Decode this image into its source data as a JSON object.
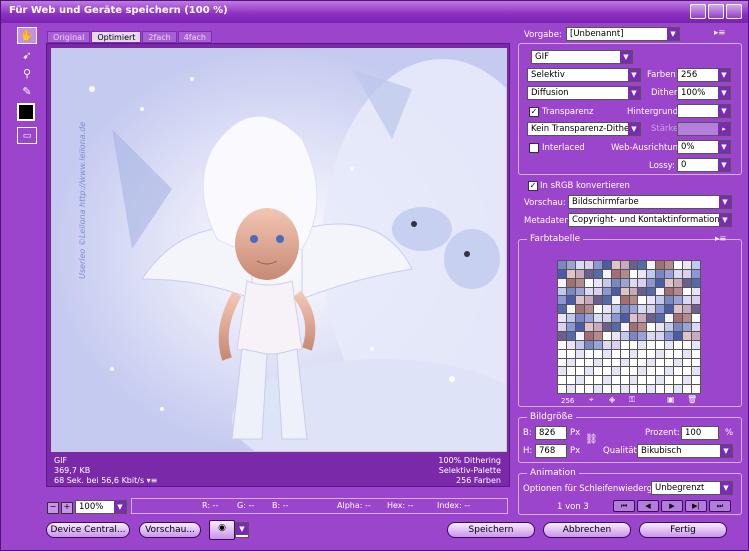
{
  "window": {
    "title": "Für Web und Geräte speichern (100 %)"
  },
  "tabs": [
    "Original",
    "Optimiert",
    "2fach",
    "4fach"
  ],
  "preview": {
    "info_left": [
      "GIF",
      "369,7 KB",
      "68 Sek. bei 56,6 Kbit/s"
    ],
    "info_right": [
      "100% Dithering",
      "Selektiv-Palette",
      "256 Farben"
    ],
    "watermark": "Userleo ©Leilona http://www.leilona.de"
  },
  "settings": {
    "preset_label": "Vorgabe:",
    "preset_value": "[Unbenannt]",
    "format": "GIF",
    "reduction": "Selektiv",
    "colors_label": "Farben:",
    "colors_value": "256",
    "dither_method": "Diffusion",
    "dither_label": "Dither:",
    "dither_value": "100%",
    "transparency_label": "Transparenz",
    "matte_label": "Hintergrund:",
    "transparency_dither": "Kein Transparenz-Dither",
    "amount_label": "Stärke:",
    "interlaced_label": "Interlaced",
    "websnap_label": "Web-Ausrichtung:",
    "websnap_value": "0%",
    "lossy_label": "Lossy:",
    "lossy_value": "0",
    "srgb_label": "In sRGB konvertieren",
    "preview_label": "Vorschau:",
    "preview_value": "Bildschirmfarbe",
    "metadata_label": "Metadaten:",
    "metadata_value": "Copyright- und Kontaktinformationen"
  },
  "color_table": {
    "title": "Farbtabelle",
    "count": "256"
  },
  "image_size": {
    "title": "Bildgröße",
    "w_label": "B:",
    "w_value": "826",
    "h_label": "H:",
    "h_value": "768",
    "unit": "Px",
    "percent_label": "Prozent:",
    "percent_value": "100",
    "percent_unit": "%",
    "quality_label": "Qualität:",
    "quality_value": "Bikubisch"
  },
  "animation": {
    "title": "Animation",
    "loop_label": "Optionen für Schleifenwiedergabe:",
    "loop_value": "Unbegrenzt",
    "frame": "1 von 3"
  },
  "status": {
    "zoom": "100%",
    "r": "R: --",
    "g": "G: --",
    "b": "B: --",
    "alpha": "Alpha: --",
    "hex": "Hex: --",
    "index": "Index: --"
  },
  "buttons": {
    "device": "Device Central...",
    "preview": "Vorschau...",
    "save": "Speichern",
    "cancel": "Abbrechen",
    "done": "Fertig"
  },
  "colors": {
    "accent": "#9b45cc",
    "title": "#7a22b2"
  }
}
